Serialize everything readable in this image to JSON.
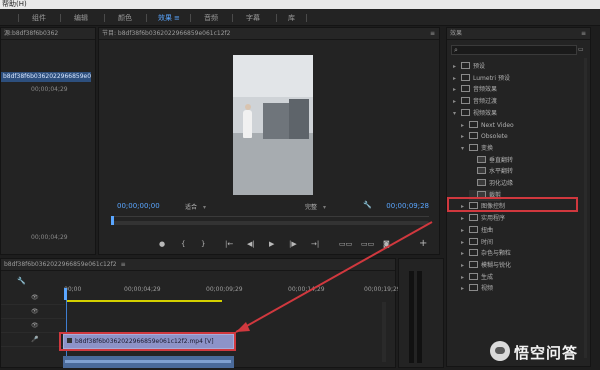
{
  "menubar": {
    "title": "帮助(H)"
  },
  "workspace_tabs": [
    {
      "label": "组件",
      "active": false
    },
    {
      "label": "编辑",
      "active": false
    },
    {
      "label": "颜色",
      "active": false
    },
    {
      "label": "效果",
      "active": true
    },
    {
      "label": "音频",
      "active": false
    },
    {
      "label": "字幕",
      "active": false
    },
    {
      "label": "库",
      "active": false
    }
  ],
  "project": {
    "header": "源:b8df38f6b0362",
    "file_name": "b8df38f6b0362022966859e061c12f2.m",
    "thumb_time_1": "00;00;04;29",
    "thumb_time_2": "00;00;04;29"
  },
  "program": {
    "header": "节目: b8df38f6b0362022966859e061c12f2",
    "timecode_current": "00;00;00;00",
    "timecode_duration": "00;00;09;28",
    "fit_label": "适合",
    "quality_label": "完整"
  },
  "effects": {
    "header": "效果",
    "tree": [
      {
        "label": "预设",
        "indent": 0,
        "type": "folder"
      },
      {
        "label": "Lumetri 预设",
        "indent": 0,
        "type": "folder"
      },
      {
        "label": "音频效果",
        "indent": 0,
        "type": "folder"
      },
      {
        "label": "音频过渡",
        "indent": 0,
        "type": "folder"
      },
      {
        "label": "视频效果",
        "indent": 0,
        "type": "folder",
        "open": true
      },
      {
        "label": "Next Video",
        "indent": 1,
        "type": "folder"
      },
      {
        "label": "Obsolete",
        "indent": 1,
        "type": "folder"
      },
      {
        "label": "变换",
        "indent": 1,
        "type": "folder",
        "open": true
      },
      {
        "label": "垂直翻转",
        "indent": 2,
        "type": "effect"
      },
      {
        "label": "水平翻转",
        "indent": 2,
        "type": "effect"
      },
      {
        "label": "羽化边缘",
        "indent": 2,
        "type": "effect"
      },
      {
        "label": "裁剪",
        "indent": 2,
        "type": "effect",
        "selected": true
      },
      {
        "label": "图像控制",
        "indent": 1,
        "type": "folder"
      },
      {
        "label": "实用程序",
        "indent": 1,
        "type": "folder"
      },
      {
        "label": "扭曲",
        "indent": 1,
        "type": "folder"
      },
      {
        "label": "时间",
        "indent": 1,
        "type": "folder"
      },
      {
        "label": "杂色与颗粒",
        "indent": 1,
        "type": "folder"
      },
      {
        "label": "模糊与锐化",
        "indent": 1,
        "type": "folder"
      },
      {
        "label": "生成",
        "indent": 1,
        "type": "folder"
      },
      {
        "label": "视频",
        "indent": 1,
        "type": "folder"
      }
    ]
  },
  "timeline": {
    "header": "b8df38f6b0362022966859e061c12f2",
    "ruler_times": [
      "00;00",
      "00;00;04;29",
      "00;00;09;29",
      "00;00;14;29",
      "00;00;19;29"
    ],
    "clip_label": "b8df38f6b0362022966859e061c12f2.mp4 [V]"
  },
  "watermark": {
    "text": "悟空问答"
  },
  "colors": {
    "accent": "#5aa6ff",
    "highlight": "#d0383e",
    "clip": "#8d93c8"
  }
}
